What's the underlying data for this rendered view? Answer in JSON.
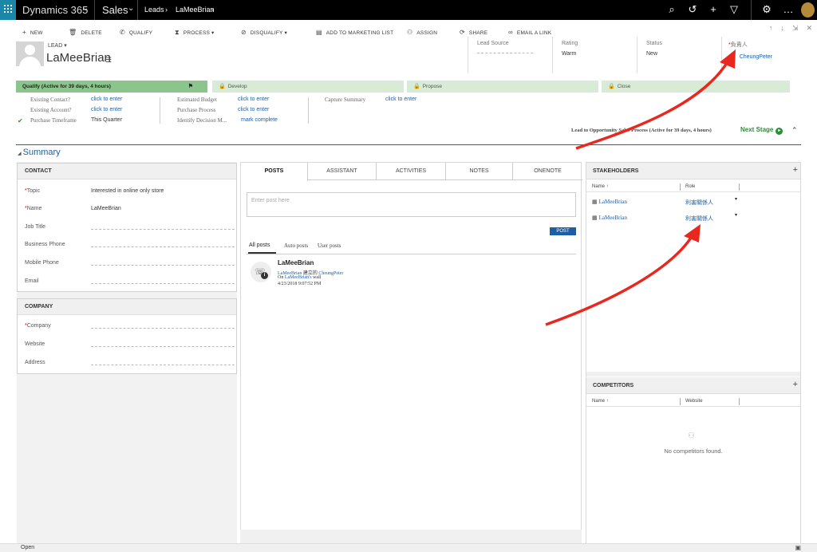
{
  "topbar": {
    "app_name": "Dynamics 365",
    "module": "Sales",
    "breadcrumb": [
      "Leads",
      "LaMeeBrian"
    ]
  },
  "commands": [
    {
      "icon": "plus-icon",
      "glyph": "+",
      "label": "NEW"
    },
    {
      "icon": "trash-icon",
      "glyph": "🗑",
      "label": "DELETE"
    },
    {
      "icon": "qualify-icon",
      "glyph": "✆",
      "label": "QUALIFY"
    },
    {
      "icon": "hourglass-icon",
      "glyph": "⧗",
      "label": "PROCESS ▾"
    },
    {
      "icon": "disqualify-icon",
      "glyph": "⊘",
      "label": "DISQUALIFY ▾"
    },
    {
      "icon": "marketing-list-icon",
      "glyph": "▤",
      "label": "ADD TO MARKETING LIST"
    },
    {
      "icon": "assign-icon",
      "glyph": "⚇",
      "label": "ASSIGN"
    },
    {
      "icon": "share-icon",
      "glyph": "⟳",
      "label": "SHARE"
    },
    {
      "icon": "link-icon",
      "glyph": "∞",
      "label": "EMAIL A LINK"
    }
  ],
  "header": {
    "entity": "LEAD ▾",
    "record_name": "LaMeeBrian",
    "fields": [
      {
        "label": "Lead Source",
        "value": ""
      },
      {
        "label": "Rating",
        "value": "Warm"
      },
      {
        "label": "Status",
        "value": "New"
      },
      {
        "label": "負責人",
        "value": "CheungPeter",
        "required": "*"
      }
    ]
  },
  "bpf": {
    "stages": [
      "Qualify (Active for 39 days, 4 hours)",
      "Develop",
      "Propose",
      "Close"
    ],
    "fields": {
      "existing_contact": {
        "label": "Existing Contact?",
        "value": "click to enter"
      },
      "existing_account": {
        "label": "Existing Account?",
        "value": "click to enter"
      },
      "purchase_timeframe": {
        "label": "Purchase Timeframe",
        "value": "This Quarter"
      },
      "estimated_budget": {
        "label": "Estimated Budget",
        "value": "click to enter"
      },
      "purchase_process": {
        "label": "Purchase Process",
        "value": "click to enter"
      },
      "identify_decision": {
        "label": "Identify Decision M...",
        "value": "mark complete"
      },
      "capture_summary": {
        "label": "Capture Summary",
        "value": "click to enter"
      }
    },
    "process_status": "Lead to Opportunity Sales Process (Active for 39 days, 4 hours)",
    "next_stage": "Next Stage"
  },
  "summary_label": "Summary",
  "contact": {
    "title": "CONTACT",
    "fields": [
      {
        "label": "Topic",
        "value": "Interested in online only store"
      },
      {
        "label": "Name",
        "value": "LaMeeBrian"
      },
      {
        "label": "Job Title",
        "value": ""
      },
      {
        "label": "Business Phone",
        "value": ""
      },
      {
        "label": "Mobile Phone",
        "value": ""
      },
      {
        "label": "Email",
        "value": ""
      }
    ]
  },
  "company": {
    "title": "COMPANY",
    "fields": [
      {
        "label": "Company",
        "value": ""
      },
      {
        "label": "Website",
        "value": ""
      },
      {
        "label": "Address",
        "value": ""
      }
    ]
  },
  "social": {
    "tabs": [
      "POSTS",
      "ASSISTANT",
      "ACTIVITIES",
      "NOTES",
      "ONENOTE"
    ],
    "post_placeholder": "Enter post here",
    "post_button": "POST",
    "post_filters": [
      "All posts",
      "Auto posts",
      "User posts"
    ],
    "post": {
      "author": "LaMeeBrian",
      "line1_a": "LaMeeBrian",
      "line1_b": "建立的",
      "line1_c": "CheungPeter",
      "line2_a": "On",
      "line2_b": "LaMeeBrian's",
      "line2_c": "wall",
      "timestamp": "4/23/2018 9:07:52 PM"
    }
  },
  "stakeholders": {
    "title": "STAKEHOLDERS",
    "col_name": "Name ↑",
    "col_role": "Role",
    "rows": [
      {
        "name": "LaMeeBrian",
        "role": "利害關係人"
      },
      {
        "name": "LaMeeBrian",
        "role": "利害關係人"
      }
    ]
  },
  "competitors": {
    "title": "COMPETITORS",
    "col_name": "Name ↑",
    "col_website": "Website",
    "empty": "No competitors found."
  },
  "status_bar": "Open",
  "colors": {
    "accent": "#1b5fa8",
    "stage_active": "#8cc58c",
    "stage_inactive": "#d7ebd7",
    "arrow": "#e8281f"
  }
}
